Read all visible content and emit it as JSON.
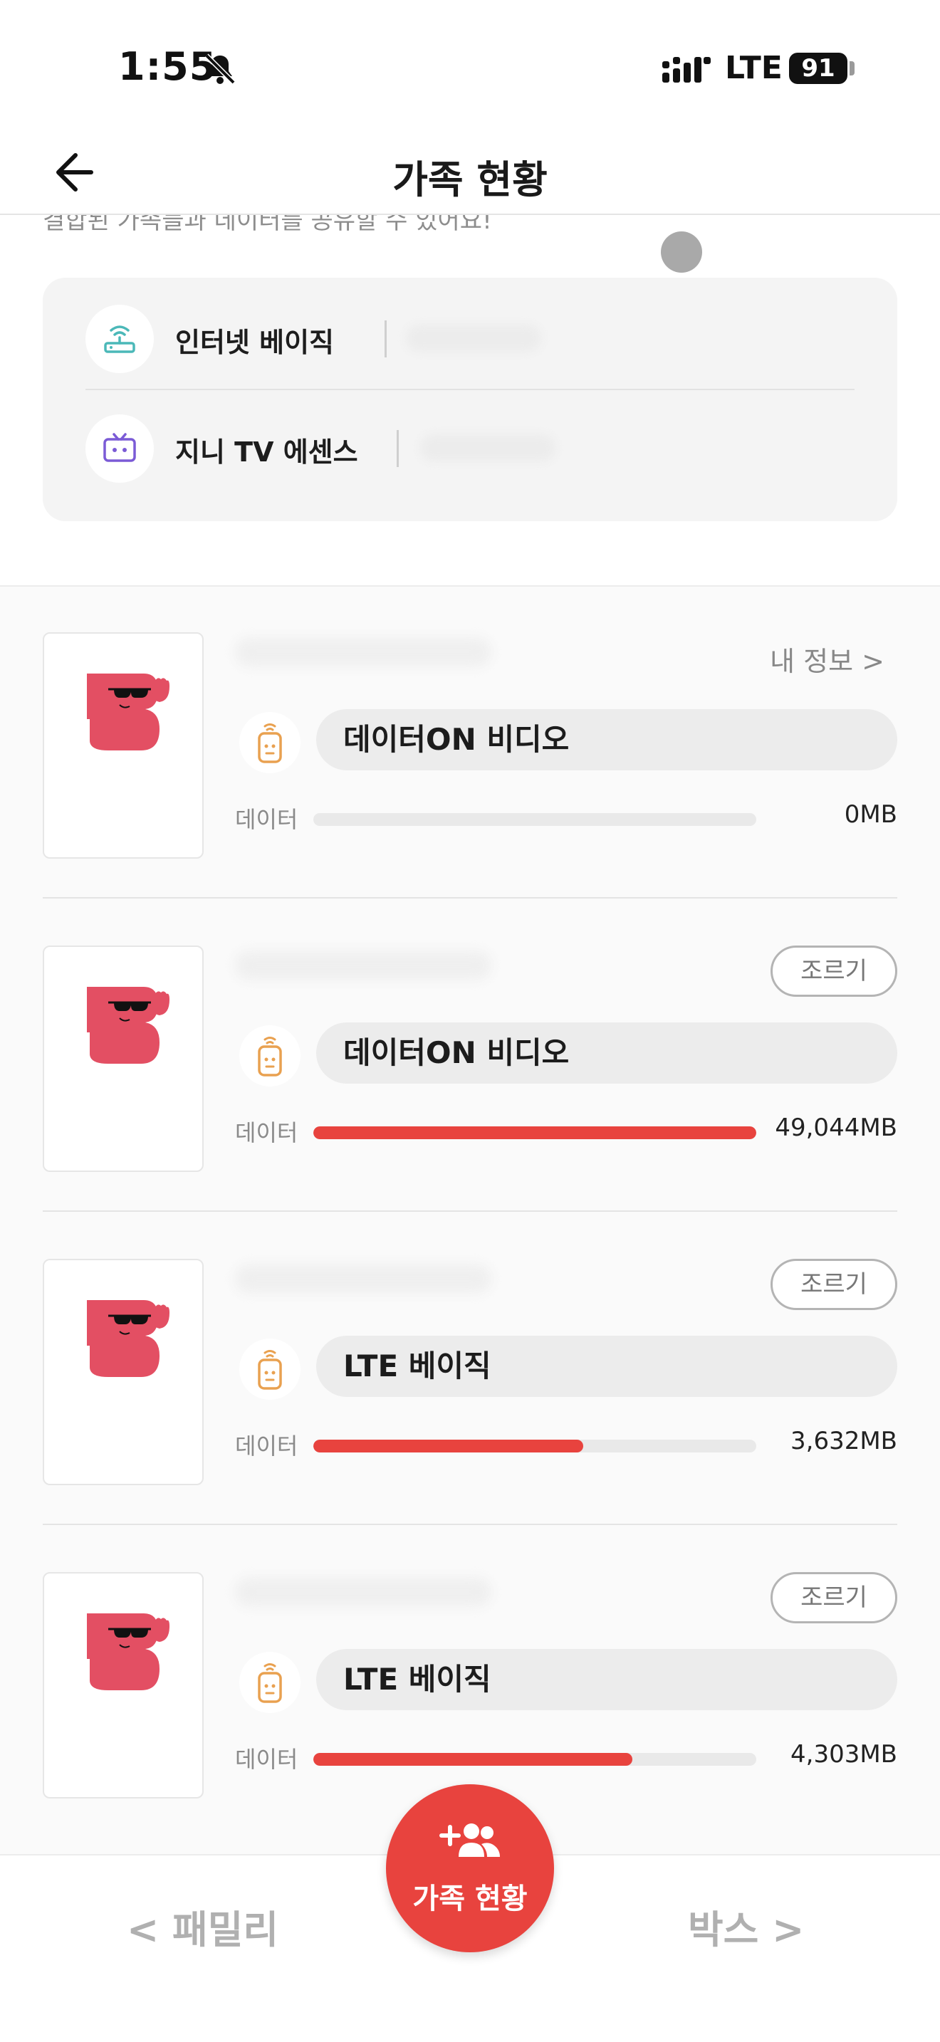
{
  "status_bar": {
    "time": "1:55",
    "network": "LTE",
    "battery": "91"
  },
  "header": {
    "title": "가족 현황"
  },
  "subtitle_cut": "결합된 가족들과 데이터를 공유할 수 있어요!",
  "services": [
    {
      "name": "인터넷 베이직",
      "icon": "router-icon"
    },
    {
      "name": "지니 TV 에센스",
      "icon": "tv-icon"
    }
  ],
  "members": [
    {
      "action": "내 정보 >",
      "plan": "데이터ON 비디오",
      "data_label": "데이터",
      "data_value": "0MB",
      "usage_fraction": 0.0
    },
    {
      "action": "조르기",
      "plan": "데이터ON 비디오",
      "data_label": "데이터",
      "data_value": "49,044MB",
      "usage_fraction": 1.0
    },
    {
      "action": "조르기",
      "plan": "LTE 베이직",
      "data_label": "데이터",
      "data_value": "3,632MB",
      "usage_fraction": 0.61
    },
    {
      "action": "조르기",
      "plan": "LTE 베이직",
      "data_label": "데이터",
      "data_value": "4,303MB",
      "usage_fraction": 0.72
    }
  ],
  "bottom_nav": {
    "prev": "< 패밀리",
    "fab": "가족 현황",
    "next": "박스 >"
  },
  "colors": {
    "accent": "#e8433e",
    "mascot": "#e34f63",
    "device": "#e9a150"
  }
}
